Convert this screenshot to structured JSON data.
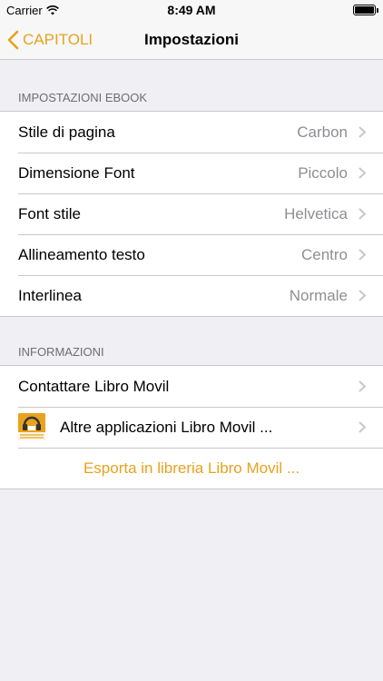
{
  "status_bar": {
    "carrier": "Carrier",
    "time": "8:49 AM"
  },
  "nav": {
    "back_label": "CAPITOLI",
    "title": "Impostazioni"
  },
  "sections": {
    "ebook": {
      "header": "IMPOSTAZIONI EBOOK",
      "rows": [
        {
          "label": "Stile di pagina",
          "value": "Carbon"
        },
        {
          "label": "Dimensione Font",
          "value": "Piccolo"
        },
        {
          "label": "Font stile",
          "value": "Helvetica"
        },
        {
          "label": "Allineamento testo",
          "value": "Centro"
        },
        {
          "label": "Interlinea",
          "value": "Normale"
        }
      ]
    },
    "info": {
      "header": "INFORMAZIONI",
      "contact_label": "Contattare Libro Movil",
      "other_apps_label": "Altre applicazioni Libro Movil ...",
      "export_label": "Esporta in libreria Libro Movil ..."
    }
  },
  "colors": {
    "accent": "#e8a21c",
    "background": "#efeff4",
    "secondary_text": "#8e8e93"
  }
}
